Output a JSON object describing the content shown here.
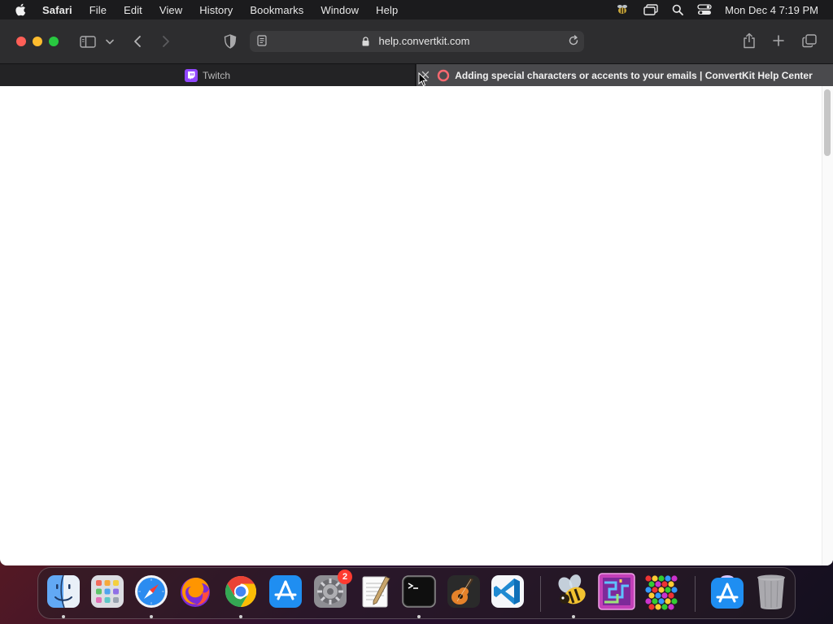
{
  "menubar": {
    "app_name": "Safari",
    "items": [
      "File",
      "Edit",
      "View",
      "History",
      "Bookmarks",
      "Window",
      "Help"
    ],
    "clock": "Mon Dec 4  7:19 PM",
    "status_icons": [
      "bee-status-icon",
      "screen-mirroring-icon",
      "spotlight-search-icon",
      "control-center-icon"
    ]
  },
  "toolbar": {
    "url": "help.convertkit.com"
  },
  "tabs": [
    {
      "label": "Twitch",
      "active": false,
      "favicon": "twitch-icon",
      "favicon_color": "#9146ff"
    },
    {
      "label": "Adding special characters or accents to your emails | ConvertKit Help Center",
      "active": true,
      "favicon": "convertkit-icon",
      "favicon_color": "#fb6970"
    }
  ],
  "dock": {
    "apps": [
      {
        "name": "Finder",
        "running": true
      },
      {
        "name": "Launchpad",
        "running": false
      },
      {
        "name": "Safari",
        "running": true
      },
      {
        "name": "Firefox",
        "running": false
      },
      {
        "name": "Google Chrome",
        "running": true
      },
      {
        "name": "App Store",
        "running": false
      },
      {
        "name": "System Settings",
        "running": false,
        "badge": "2"
      },
      {
        "name": "TextEdit",
        "running": false
      },
      {
        "name": "Terminal",
        "running": true
      },
      {
        "name": "GarageBand",
        "running": false
      },
      {
        "name": "Visual Studio Code",
        "running": false
      },
      {
        "name": "Bee App",
        "running": true
      },
      {
        "name": "Maze Game",
        "running": false
      },
      {
        "name": "Bubble Game",
        "running": false
      },
      {
        "name": "App Store Downloads",
        "running": false
      },
      {
        "name": "Trash",
        "running": false
      }
    ]
  },
  "colors": {
    "menubar_bg": "#1b1b1d",
    "toolbar_bg": "#2d2d2f",
    "active_tab_bg": "#4a4a4d",
    "close": "#ff5f57",
    "minimize": "#febc2e",
    "zoom": "#28c840"
  }
}
